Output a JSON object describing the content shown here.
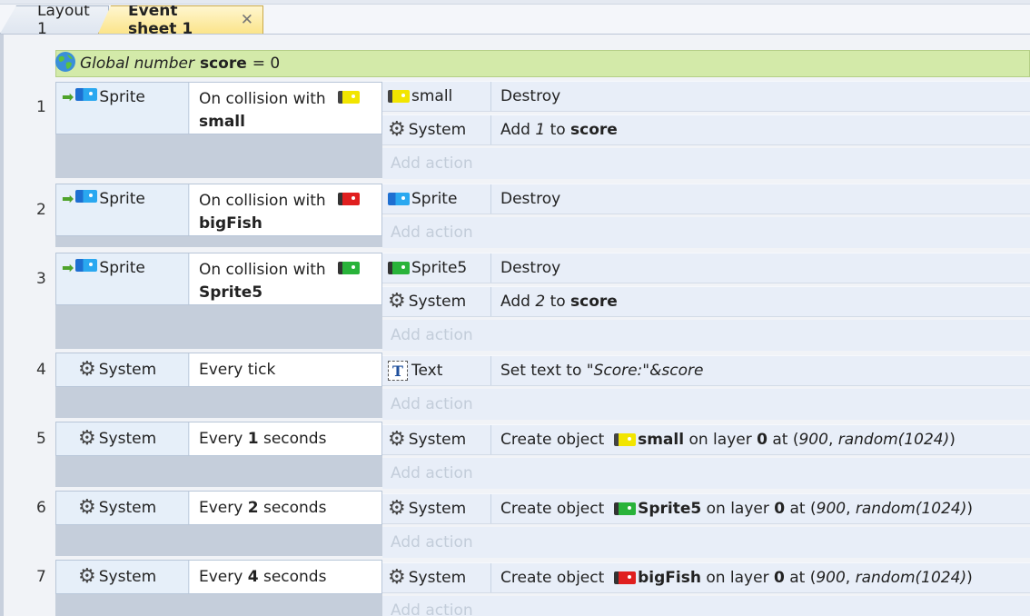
{
  "tabs": [
    {
      "label": "Layout 1"
    },
    {
      "label": "Event sheet 1",
      "close": "✕"
    }
  ],
  "global": {
    "prefix": "Global number",
    "name": "score",
    "suffix": "= 0"
  },
  "add_action_label": "Add action",
  "events": [
    {
      "num": "1",
      "cond_obj": "Sprite",
      "cond_pre": "On collision with",
      "cond_target": "small"
    },
    {
      "num": "2",
      "cond_obj": "Sprite",
      "cond_pre": "On collision with",
      "cond_target": "bigFish"
    },
    {
      "num": "3",
      "cond_obj": "Sprite",
      "cond_pre": "On collision with",
      "cond_target": "Sprite5"
    },
    {
      "num": "4",
      "cond_obj": "System",
      "cond_text": "Every tick"
    },
    {
      "num": "5",
      "cond_obj": "System",
      "cond_pre": "Every",
      "cond_num": "1",
      "cond_post": "seconds"
    },
    {
      "num": "6",
      "cond_obj": "System",
      "cond_pre": "Every",
      "cond_num": "2",
      "cond_post": "seconds"
    },
    {
      "num": "7",
      "cond_obj": "System",
      "cond_pre": "Every",
      "cond_num": "4",
      "cond_post": "seconds"
    }
  ],
  "actions": {
    "e1a1": {
      "obj": "small",
      "text": "Destroy"
    },
    "e1a2": {
      "obj": "System",
      "pre": "Add",
      "num": "1",
      "mid": "to",
      "var": "score"
    },
    "e2a1": {
      "obj": "Sprite",
      "text": "Destroy"
    },
    "e3a1": {
      "obj": "Sprite5",
      "text": "Destroy"
    },
    "e3a2": {
      "obj": "System",
      "pre": "Add",
      "num": "2",
      "mid": "to",
      "var": "score"
    },
    "e4a1": {
      "obj": "Text",
      "pre": "Set text to",
      "expr": "\"Score:\"&score"
    },
    "e5a1": {
      "obj": "System",
      "pre": "Create object",
      "target": "small",
      "layer_pre": "on layer",
      "layer": "0",
      "at": "at (",
      "x": "900",
      "comma": ",",
      "y": "random(1024)",
      "close": ")"
    },
    "e6a1": {
      "obj": "System",
      "pre": "Create object",
      "target": "Sprite5",
      "layer_pre": "on layer",
      "layer": "0",
      "at": "at (",
      "x": "900",
      "comma": ",",
      "y": "random(1024)",
      "close": ")"
    },
    "e7a1": {
      "obj": "System",
      "pre": "Create object",
      "target": "bigFish",
      "layer_pre": "on layer",
      "layer": "0",
      "at": "at (",
      "x": "900",
      "comma": ",",
      "y": "random(1024)",
      "close": ")"
    }
  },
  "icons": {
    "trigger": "green-arrow",
    "sprite": "blue-fish",
    "small": "yellow-fish",
    "bigFish": "red-fish",
    "Sprite5": "green-fish",
    "system": "gear",
    "text": "text-T",
    "global": "globe"
  },
  "colors": {
    "global_bg": "#d3eaa9",
    "active_tab": "#fbe48a",
    "condition_bg": "#e6eff9",
    "action_bg": "#e8eef8"
  }
}
